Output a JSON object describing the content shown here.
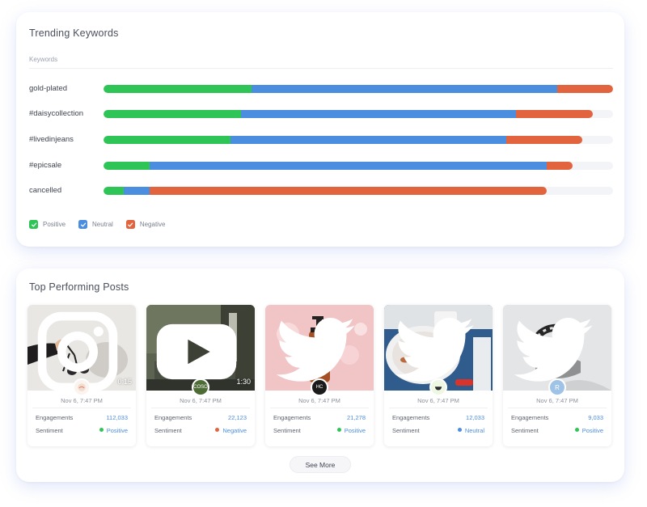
{
  "trending": {
    "title": "Trending Keywords",
    "column_header": "Keywords",
    "colors": {
      "positive": "#2ec556",
      "neutral": "#4b8ee0",
      "negative": "#e2643e"
    },
    "keywords": [
      {
        "label": "gold-plated",
        "positive": 29,
        "neutral": 60,
        "negative": 11
      },
      {
        "label": "#daisycollection",
        "positive": 27,
        "neutral": 54,
        "negative": 15
      },
      {
        "label": "#livedinjeans",
        "positive": 25,
        "neutral": 54,
        "negative": 15
      },
      {
        "label": "#epicsale",
        "positive": 9,
        "neutral": 78,
        "negative": 5
      },
      {
        "label": "cancelled",
        "positive": 4,
        "neutral": 5,
        "negative": 78
      }
    ],
    "legend": [
      {
        "label": "Positive",
        "color": "#2ec556"
      },
      {
        "label": "Neutral",
        "color": "#4b8ee0"
      },
      {
        "label": "Negative",
        "color": "#e2643e"
      }
    ]
  },
  "posts": {
    "title": "Top Performing Posts",
    "engagements_label": "Engagements",
    "sentiment_label": "Sentiment",
    "items": [
      {
        "platform": "instagram-icon",
        "duration": "0:15",
        "avatar_text": "",
        "date": "Nov 6, 7:47 PM",
        "engagements": "112,033",
        "sentiment": "Positive",
        "sentiment_color": "#2ec556"
      },
      {
        "platform": "youtube-icon",
        "duration": "1:30",
        "avatar_text": "COSO",
        "date": "Nov 6, 7:47 PM",
        "engagements": "22,123",
        "sentiment": "Negative",
        "sentiment_color": "#e2643e"
      },
      {
        "platform": "twitter-icon",
        "duration": "",
        "avatar_text": "HC",
        "date": "Nov 6, 7:47 PM",
        "engagements": "21,278",
        "sentiment": "Positive",
        "sentiment_color": "#2ec556"
      },
      {
        "platform": "twitter-icon",
        "duration": "",
        "avatar_text": "",
        "date": "Nov 6, 7:47 PM",
        "engagements": "12,033",
        "sentiment": "Neutral",
        "sentiment_color": "#4b8ee0"
      },
      {
        "platform": "twitter-icon",
        "duration": "",
        "avatar_text": "R",
        "date": "Nov 6, 7:47 PM",
        "engagements": "9,033",
        "sentiment": "Positive",
        "sentiment_color": "#2ec556"
      }
    ],
    "see_more_label": "See More"
  }
}
